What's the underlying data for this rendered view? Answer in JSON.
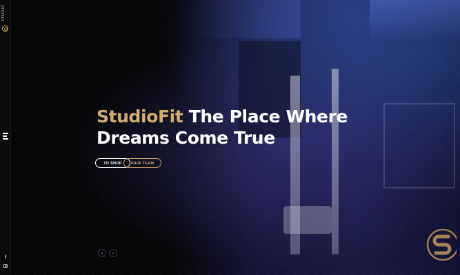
{
  "brand": {
    "logo_text": "STUDIO"
  },
  "sidebar": {
    "menu_icon": "menu-icon",
    "social": [
      {
        "name": "facebook-icon",
        "glyph": "f"
      },
      {
        "name": "instagram-icon"
      }
    ]
  },
  "hero": {
    "headline_brand": "StudioFit",
    "headline_rest_line1": "The Place Where",
    "headline_line2": "Dreams Come True",
    "buttons": {
      "shop": "TO SHOP",
      "team": "VIEW TEAM"
    },
    "arrows": {
      "prev": "‹",
      "next": "›"
    }
  },
  "colors": {
    "accent": "#d2ad73",
    "background": "#060608",
    "text": "#ffffff"
  }
}
